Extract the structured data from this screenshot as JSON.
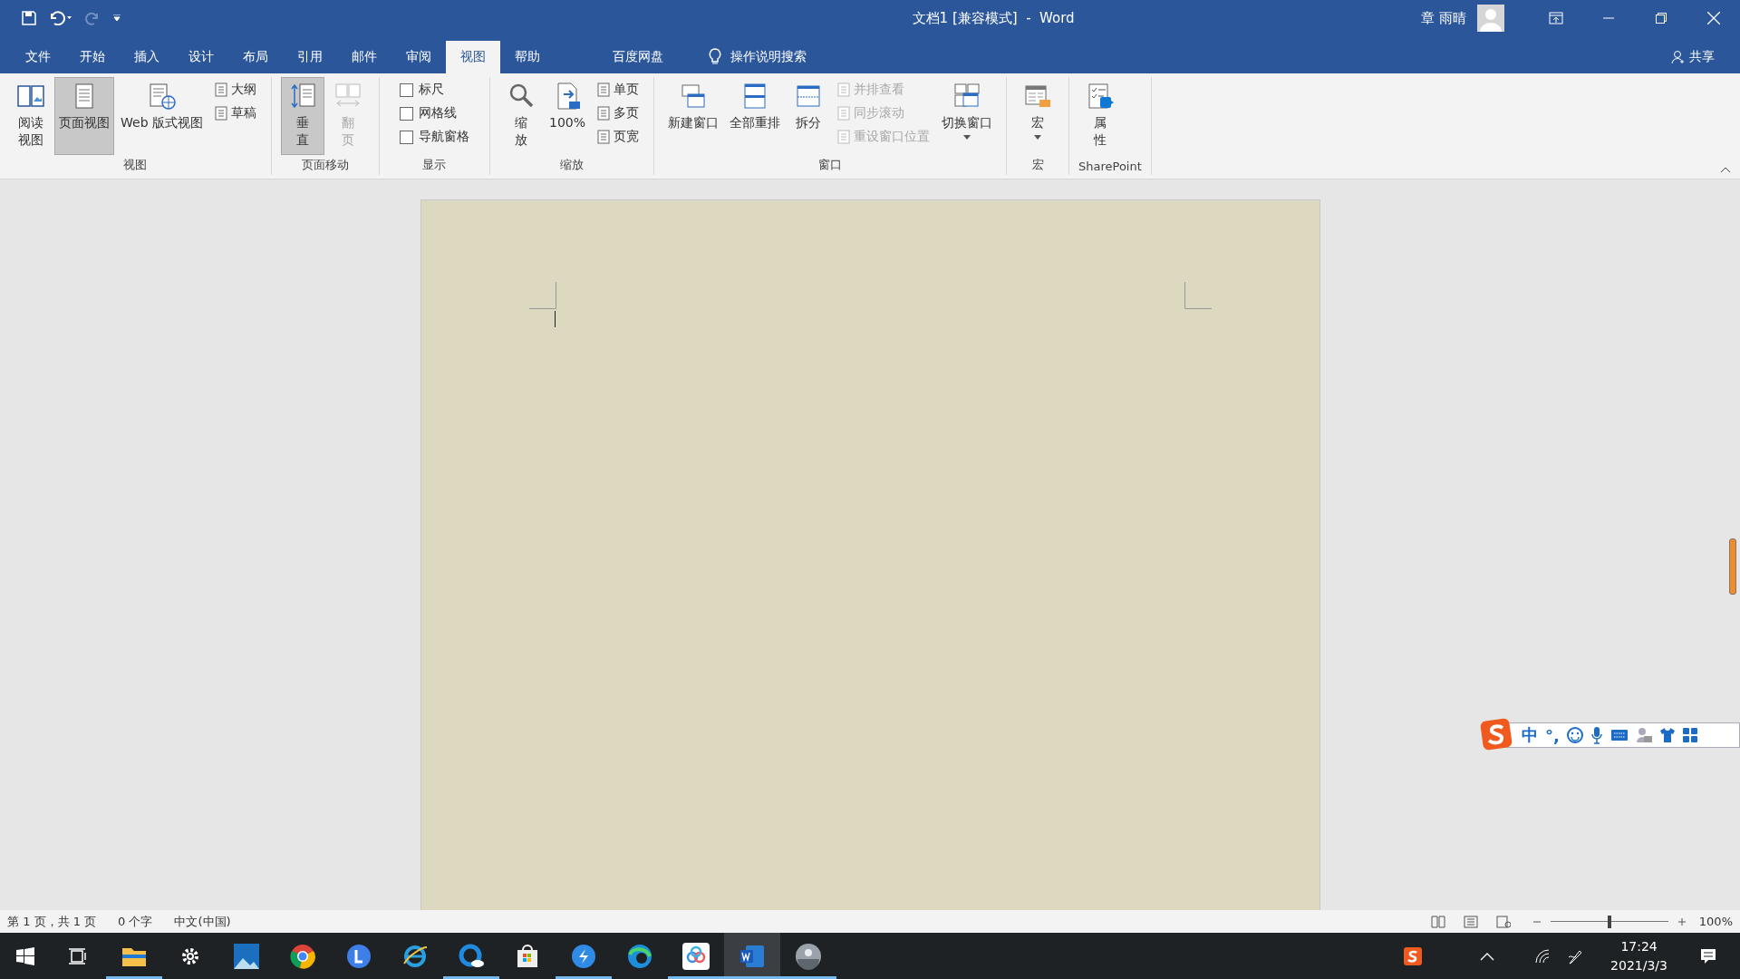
{
  "title_bar": {
    "title": "文档1 [兼容模式]  -  Word",
    "user": "章 雨晴"
  },
  "tabs": [
    {
      "label": "文件",
      "selected": false
    },
    {
      "label": "开始",
      "selected": false
    },
    {
      "label": "插入",
      "selected": false
    },
    {
      "label": "设计",
      "selected": false
    },
    {
      "label": "布局",
      "selected": false
    },
    {
      "label": "引用",
      "selected": false
    },
    {
      "label": "邮件",
      "selected": false
    },
    {
      "label": "审阅",
      "selected": false
    },
    {
      "label": "视图",
      "selected": true
    },
    {
      "label": "帮助",
      "selected": false
    },
    {
      "label": "百度网盘",
      "selected": false
    }
  ],
  "search": {
    "label": "操作说明搜索"
  },
  "share": {
    "label": "共享"
  },
  "ribbon": [
    {
      "label": "视图",
      "items": [
        {
          "kind": "large",
          "label": "阅读视图",
          "wrap": true,
          "selected": false
        },
        {
          "kind": "large",
          "label": "页面视图",
          "selected": true
        },
        {
          "kind": "large",
          "label": "Web 版式视图",
          "selected": false
        },
        {
          "kind": "small",
          "label": "大纲",
          "disabled": false
        },
        {
          "kind": "small",
          "label": "草稿",
          "disabled": false
        }
      ]
    },
    {
      "label": "页面移动",
      "items": [
        {
          "kind": "large",
          "label": "垂直",
          "wrap": true,
          "selected": true
        },
        {
          "kind": "large",
          "label": "翻页",
          "wrap": true,
          "selected": false,
          "disabled": true
        }
      ]
    },
    {
      "label": "显示",
      "items": [
        {
          "kind": "checkbox",
          "label": "标尺",
          "checked": false
        },
        {
          "kind": "checkbox",
          "label": "网格线",
          "checked": false
        },
        {
          "kind": "checkbox",
          "label": "导航窗格",
          "checked": false
        }
      ]
    },
    {
      "label": "缩放",
      "items": [
        {
          "kind": "large",
          "label": "缩放",
          "wrap": true,
          "selected": false
        },
        {
          "kind": "large",
          "label": "100%",
          "selected": false
        },
        {
          "kind": "small",
          "label": "单页",
          "disabled": false
        },
        {
          "kind": "small",
          "label": "多页",
          "disabled": false
        },
        {
          "kind": "small",
          "label": "页宽",
          "disabled": false
        }
      ]
    },
    {
      "label": "窗口",
      "items": [
        {
          "kind": "large",
          "label": "新建窗口",
          "selected": false
        },
        {
          "kind": "large",
          "label": "全部重排",
          "selected": false
        },
        {
          "kind": "large",
          "label": "拆分",
          "selected": false
        },
        {
          "kind": "small",
          "label": "并排查看",
          "disabled": true
        },
        {
          "kind": "small",
          "label": "同步滚动",
          "disabled": true
        },
        {
          "kind": "small",
          "label": "重设窗口位置",
          "disabled": true
        },
        {
          "kind": "large",
          "label": "切换窗口",
          "selected": false,
          "dropdown": true
        }
      ]
    },
    {
      "label": "宏",
      "items": [
        {
          "kind": "large",
          "label": "宏",
          "selected": false,
          "dropdown": true
        }
      ]
    },
    {
      "label": "SharePoint",
      "items": [
        {
          "kind": "large",
          "label": "属性",
          "wrap": true,
          "selected": false
        }
      ]
    }
  ],
  "ime_toolbar": {
    "mode": "中",
    "punctuation": "°,"
  },
  "status_bar": {
    "page": "第 1 页，共 1 页",
    "words": "0 个字",
    "language": "中文(中国)",
    "zoom": "100%",
    "zoom_level": {
      "level": 0.5
    }
  },
  "taskbar": {
    "apps": [
      {
        "running": false,
        "selected": false
      },
      {
        "running": false,
        "selected": false
      },
      {
        "running": true,
        "selected": false
      },
      {
        "running": false,
        "selected": false
      },
      {
        "running": false,
        "selected": false
      },
      {
        "running": false,
        "selected": false
      },
      {
        "running": false,
        "selected": false
      },
      {
        "running": false,
        "selected": false
      },
      {
        "running": true,
        "selected": false
      },
      {
        "running": false,
        "selected": false
      },
      {
        "running": true,
        "selected": false
      },
      {
        "running": false,
        "selected": false
      },
      {
        "running": true,
        "selected": false
      },
      {
        "running": true,
        "selected": true
      },
      {
        "running": true,
        "selected": false
      }
    ],
    "time": "17:24",
    "date": "2021/3/3"
  }
}
